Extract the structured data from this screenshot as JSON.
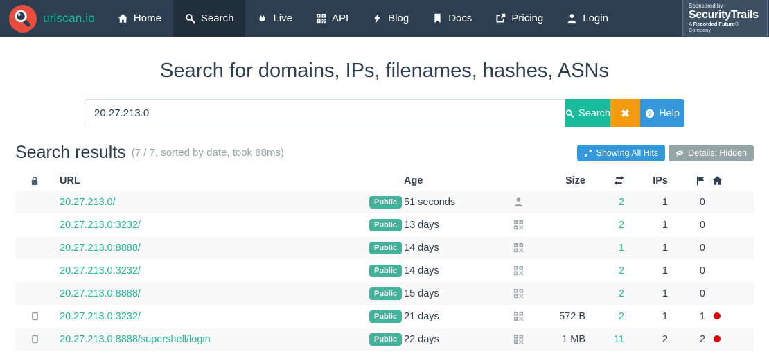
{
  "navbar": {
    "brand": "urlscan.io",
    "items": [
      {
        "label": "Home"
      },
      {
        "label": "Search"
      },
      {
        "label": "Live"
      },
      {
        "label": "API"
      },
      {
        "label": "Blog"
      },
      {
        "label": "Docs"
      },
      {
        "label": "Pricing"
      },
      {
        "label": "Login"
      }
    ],
    "sponsor": {
      "line1": "Sponsored by",
      "line2": "SecurityTrails",
      "line3_a": "A ",
      "line3_b": "Recorded Future",
      "line3_c": "® Company"
    }
  },
  "search": {
    "heading": "Search for domains, IPs, filenames, hashes, ASNs",
    "query": "20.27.213.0",
    "search_label": "Search",
    "clear_label": "✖",
    "help_label": "Help"
  },
  "results": {
    "title": "Search results",
    "meta": "(7 / 7, sorted by date, took 88ms)",
    "hits_button": "Showing All Hits",
    "details_button": "Details: Hidden",
    "columns": {
      "url": "URL",
      "age": "Age",
      "size": "Size",
      "ips": "IPs"
    },
    "rows": [
      {
        "url": "20.27.213.0/",
        "badge": "Public",
        "age": "51 seconds",
        "source": "user",
        "size": "",
        "requests": "2",
        "ips": "1",
        "flags": "0",
        "device": false,
        "dot": false
      },
      {
        "url": "20.27.213.0:3232/",
        "badge": "Public",
        "age": "13 days",
        "source": "qr",
        "size": "",
        "requests": "2",
        "ips": "1",
        "flags": "0",
        "device": false,
        "dot": false
      },
      {
        "url": "20.27.213.0:8888/",
        "badge": "Public",
        "age": "14 days",
        "source": "qr",
        "size": "",
        "requests": "1",
        "ips": "1",
        "flags": "0",
        "device": false,
        "dot": false
      },
      {
        "url": "20.27.213.0:3232/",
        "badge": "Public",
        "age": "14 days",
        "source": "qr",
        "size": "",
        "requests": "2",
        "ips": "1",
        "flags": "0",
        "device": false,
        "dot": false
      },
      {
        "url": "20.27.213.0:8888/",
        "badge": "Public",
        "age": "15 days",
        "source": "qr",
        "size": "",
        "requests": "2",
        "ips": "1",
        "flags": "0",
        "device": false,
        "dot": false
      },
      {
        "url": "20.27.213.0:3232/",
        "badge": "Public",
        "age": "21 days",
        "source": "qr",
        "size": "572 B",
        "requests": "2",
        "ips": "1",
        "flags": "1",
        "device": true,
        "dot": true
      },
      {
        "url": "20.27.213.0:8888/supershell/login",
        "badge": "Public",
        "age": "22 days",
        "source": "qr",
        "size": "1 MB",
        "requests": "11",
        "ips": "2",
        "flags": "2",
        "device": true,
        "dot": true
      }
    ]
  },
  "colors": {
    "navbar_bg": "#2c3e50",
    "navbar_active_bg": "#212f3d",
    "brand_teal": "#18bc9c",
    "logo_red": "#e74c3c",
    "success_green": "#18bc9c",
    "warning_orange": "#f39c12",
    "info_blue": "#3498db",
    "muted_gray": "#95a5a6",
    "heading_navy": "#2c3e50",
    "badge_green": "#45b39b",
    "link_teal": "#24b699",
    "stripe_bg": "#f9f9f9",
    "danger_red": "#e00000",
    "sponsor_bg": "#3d4f63"
  }
}
